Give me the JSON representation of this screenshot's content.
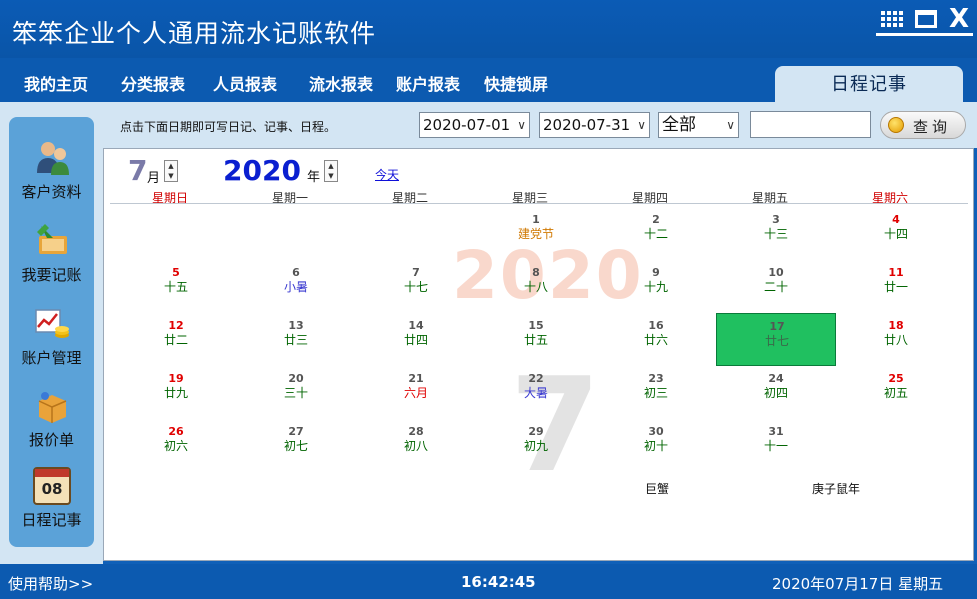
{
  "app": {
    "title": "笨笨企业个人通用流水记账软件"
  },
  "menu": {
    "items": [
      "我的主页",
      "分类报表",
      "人员报表",
      "流水报表",
      "账户报表",
      "快捷锁屏"
    ],
    "active_tab": "日程记事"
  },
  "sidebar": {
    "items": [
      {
        "label": "客户资料",
        "icon": "customer-icon"
      },
      {
        "label": "我要记账",
        "icon": "bookkeeping-icon"
      },
      {
        "label": "账户管理",
        "icon": "account-chart-icon"
      },
      {
        "label": "报价单",
        "icon": "package-icon"
      },
      {
        "label": "日程记事",
        "icon": "calendar-icon",
        "icon_text": "08"
      }
    ]
  },
  "filter": {
    "hint": "点击下面日期即可写日记、记事、日程。",
    "start_date": "2020-07-01",
    "end_date": "2020-07-31",
    "category": "全部",
    "search_value": "",
    "query_button": "查询"
  },
  "calendar": {
    "month": "7",
    "month_label": "月",
    "year": "2020",
    "year_label": "年",
    "today_link": "今天",
    "weekdays": [
      "星期日",
      "星期一",
      "星期二",
      "星期三",
      "星期四",
      "星期五",
      "星期六"
    ],
    "watermark_year": "2020",
    "watermark_month": "7",
    "selected_day": "17",
    "days": [
      {
        "d": "1",
        "l": "建党节",
        "lc": "orange"
      },
      {
        "d": "2",
        "l": "十二"
      },
      {
        "d": "3",
        "l": "十三"
      },
      {
        "d": "4",
        "l": "十四"
      },
      {
        "d": "5",
        "l": "十五"
      },
      {
        "d": "6",
        "l": "小暑",
        "lc": "blue"
      },
      {
        "d": "7",
        "l": "十七"
      },
      {
        "d": "8",
        "l": "十八"
      },
      {
        "d": "9",
        "l": "十九"
      },
      {
        "d": "10",
        "l": "二十"
      },
      {
        "d": "11",
        "l": "廿一"
      },
      {
        "d": "12",
        "l": "廿二"
      },
      {
        "d": "13",
        "l": "廿三"
      },
      {
        "d": "14",
        "l": "廿四"
      },
      {
        "d": "15",
        "l": "廿五"
      },
      {
        "d": "16",
        "l": "廿六"
      },
      {
        "d": "17",
        "l": "廿七"
      },
      {
        "d": "18",
        "l": "廿八"
      },
      {
        "d": "19",
        "l": "廿九"
      },
      {
        "d": "20",
        "l": "三十"
      },
      {
        "d": "21",
        "l": "六月",
        "lc": "red"
      },
      {
        "d": "22",
        "l": "大暑",
        "lc": "blue"
      },
      {
        "d": "23",
        "l": "初三"
      },
      {
        "d": "24",
        "l": "初四"
      },
      {
        "d": "25",
        "l": "初五"
      },
      {
        "d": "26",
        "l": "初六"
      },
      {
        "d": "27",
        "l": "初七"
      },
      {
        "d": "28",
        "l": "初八"
      },
      {
        "d": "29",
        "l": "初九"
      },
      {
        "d": "30",
        "l": "初十"
      },
      {
        "d": "31",
        "l": "十一"
      }
    ],
    "zodiac_sign": "巨蟹",
    "ganzhi": "庚子鼠年"
  },
  "status": {
    "help": "使用帮助>>",
    "time": "16:42:45",
    "date": "2020年07月17日  星期五"
  },
  "colors": {
    "brand_blue": "#0c5ab0",
    "panel_light": "#d3e5f3",
    "selected_day": "#20c060",
    "weekend_red": "#e00000"
  }
}
